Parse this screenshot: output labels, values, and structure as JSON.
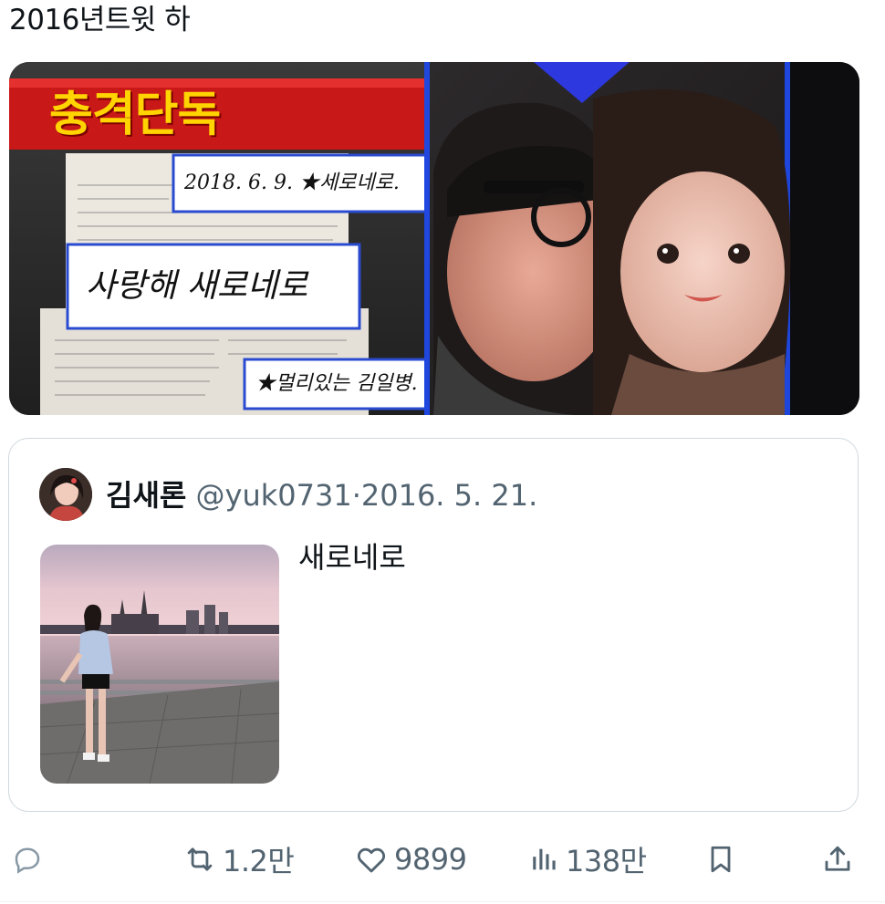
{
  "tweet": {
    "text": "2016년트윗   하"
  },
  "media": {
    "headline_badge": "충격단독",
    "note_date": "2018. 6. 9.  ★세로네로.",
    "note_love": "사랑해  새로네로",
    "note_sign": "★멀리있는  김일병."
  },
  "quoted_tweet": {
    "author_name": "김새론",
    "author_handle": "@yuk0731",
    "separator": "·",
    "date": "2016. 5. 21.",
    "text": "새로네로"
  },
  "actions": {
    "retweet_count": "1.2만",
    "like_count": "9899",
    "view_count": "138만"
  },
  "colors": {
    "text_primary": "#0f1419",
    "text_secondary": "#536471",
    "border": "#cfd9de",
    "badge_red": "#d11f1f",
    "badge_yellow": "#ffd400",
    "glow_blue": "#1e4dff"
  }
}
